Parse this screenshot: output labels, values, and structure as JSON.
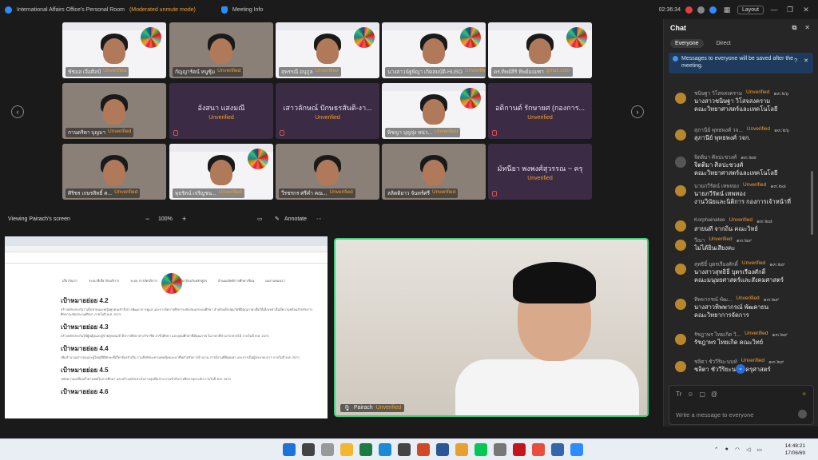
{
  "titlebar": {
    "room": "International Affairs Office's Personal Room",
    "moderated": "(Moderated unmute mode)",
    "meeting_info": "Meeting Info",
    "time": "02:36:34",
    "layout": "Layout"
  },
  "unverified": "Unverified",
  "gallery": {
    "tiles": [
      {
        "name": "ชัชมล เจือศิลป์",
        "video": true
      },
      {
        "name": "กัญญารัตน์ หนูซุ้ม",
        "video": true
      },
      {
        "name": "สุพรรณี อนุกูล",
        "video": true
      },
      {
        "name": "นางสาวนัฐพิญา เกิดสมบัติ-HUSO",
        "video": true
      },
      {
        "name": "ดร.ทิพย์สิริ ทิพย์มณฑา",
        "video": true,
        "suffix": "gmail.com"
      },
      {
        "name": "กานดริดา บุญมา",
        "video": true
      },
      {
        "name": "อังสนา แสงมณี",
        "video": false
      },
      {
        "name": "เสาวลักษณ์ ปักษธรสันติ-งา...",
        "video": false
      },
      {
        "name": "พิชญา บุญจุ่ง หน่ว...",
        "video": true
      },
      {
        "name": "อดิกานต์ รักษายศ (กองการ...",
        "video": false
      },
      {
        "name": "ศิริชร เกษรสิทธิ์ ค...",
        "video": true
      },
      {
        "name": "พุธรัตน์ เจริญชน...",
        "video": true
      },
      {
        "name": "วีรชรกร ศรีคำ คณ...",
        "video": true
      },
      {
        "name": "ลลิตติยาว จันทร์ศรี",
        "video": true
      },
      {
        "name": "มัทนียา พงพงศ์สุวรรณ ~ ครุ",
        "video": false
      }
    ]
  },
  "viewbar": {
    "viewing": "Viewing Pairach's screen",
    "minus": "−",
    "zoom": "100%",
    "plus": "+",
    "annotate": "Annotate"
  },
  "share": {
    "nav": [
      "เกี่ยวกับเรา",
      "ระบบ ที่เกี่ยวกับบริการ",
      "ระบบ การจัดบริการ",
      "ระบบ ที่เกี่ยวข้องกับหลักสูตร",
      "ด้านผลลัพธ์การศึกษาเรียน",
      "ผลงานของเรา"
    ],
    "sections": [
      {
        "h": "เป้าหมายย่อย 4.2",
        "p": "สร้างหลักประกันว่าเด็กชายและหญิงทุกคนเข้าถึงการพัฒนาการดูแล และการจัดการศึกษาระดับก่อนประถมศึกษา สำหรับเด็กปฐมวัยที่มีคุณภาพ เพื่อให้เด็กเหล่านั้นมีความพร้อมสำหรับการศึกษาระดับประถมศึกษา ภายในปี พ.ศ. 2573"
      },
      {
        "h": "เป้าหมายย่อย 4.3",
        "p": "สร้างหลักประกันให้ผู้หญิงและผู้ชายทุกคนเข้าถึงการศึกษาทางวิชาชีพ อาชีวศึกษา และอุดมศึกษาที่มีคุณภาพ ในราคาที่สามารถจ่ายได้ ภายในปี พ.ศ. 2573"
      },
      {
        "h": "เป้าหมายย่อย 4.4",
        "p": "เพิ่มจำนวนเยาวชนและผู้ใหญ่ที่มีทักษะที่เกี่ยวข้องจำเป็น รวมถึงทักษะทางเทคนิคและอาชีพสำหรับการจ้างงาน การมีงานที่มีคุณค่า และการเป็นผู้ประกอบการ ภายในปี พ.ศ. 2573"
      },
      {
        "h": "เป้าหมายย่อย 4.5",
        "p": "ขจัดความเหลื่อมล้ำทางเพศในการศึกษา และสร้างหลักประกันว่ากลุ่มที่เปราะบางเข้าถึงการศึกษาทุกระดับ ภายในปี พ.ศ. 2573"
      },
      {
        "h": "เป้าหมายย่อย 4.6",
        "p": ""
      }
    ]
  },
  "speaker": {
    "name": "Pairach"
  },
  "chat": {
    "title": "Chat",
    "tabs": [
      "Everyone",
      "Direct"
    ],
    "notice": "Messages to everyone will be saved after the meeting.",
    "messages": [
      {
        "sender": "ชนิษฐา วิโสจสงคราม",
        "time": "๑๓:๒๖",
        "body": [
          "นางสาวชนิษฐา วิโสจสงคราม",
          "คณะวิทยาศาสตร์และเทคโนโลยี"
        ]
      },
      {
        "sender": "สุภานีย์ พุทธพงศ์ วจ...",
        "time": "๑๓:๒๖",
        "body": [
          "สุภานีย์ พุทธพงศ์ วจก."
        ]
      },
      {
        "sender": "จิตติมา ศิลปะชวงศ์",
        "time": "๑๓:๒๗",
        "body": [
          "จิตติมา ศิลปะชวงศ์",
          "คณะวิทยาศาสตร์และเทคโนโลยี"
        ],
        "no_badge": true
      },
      {
        "sender": "นายภวีรัตน์ เทพทอง",
        "time": "๑๓:๒๘",
        "body": [
          "นายภวีรัตน์ เทพทอง",
          "งานวินัยและนิติการ กองการเจ้าหน้าที่"
        ]
      },
      {
        "sender": "Korphainatee",
        "time": "๑๓:๒๘",
        "body": [
          "สายนที จากถิ่น คณะวิทย์"
        ]
      },
      {
        "sender": "วีณา",
        "time": "๑๓:๒๙",
        "body": [
          "ไม่ได้ยินเสียงคะ"
        ]
      },
      {
        "sender": "สุทธิธิ์ บุตรเรืองศักดิ์",
        "time": "๑๓:๒๙",
        "body": [
          "นางสาวสุทธิธิ์ บุตรเรืองศักดิ์",
          "คณะมนุษยศาสตร์และสังคมศาสตร์"
        ]
      },
      {
        "sender": "ทิพพากรณ์ พัฒ...",
        "time": "๑๓:๒๙",
        "body": [
          "นางสาวทิพพากรณ์ พัฒคายน",
          "คณะวิทยาการจัดการ"
        ]
      },
      {
        "sender": "รัชฎาพร ไทยเกิด วิ...",
        "time": "๑๓:๒๙",
        "body": [
          "รัชฎาพร ไทยเกิด คณะวิทย์"
        ]
      },
      {
        "sender": "ชลิตา ชัววีริยะนนท์",
        "time": "๑๓:๒๙",
        "body": [
          "ชลิตา ชัววีริยะนนท์ ครุศาสตร์"
        ]
      }
    ],
    "placeholder": "Write a message to everyone",
    "tools": [
      "Tr",
      "☺",
      "▢",
      "@"
    ]
  },
  "taskbar": {
    "time": "14:48:21",
    "date": "17/06/69"
  }
}
